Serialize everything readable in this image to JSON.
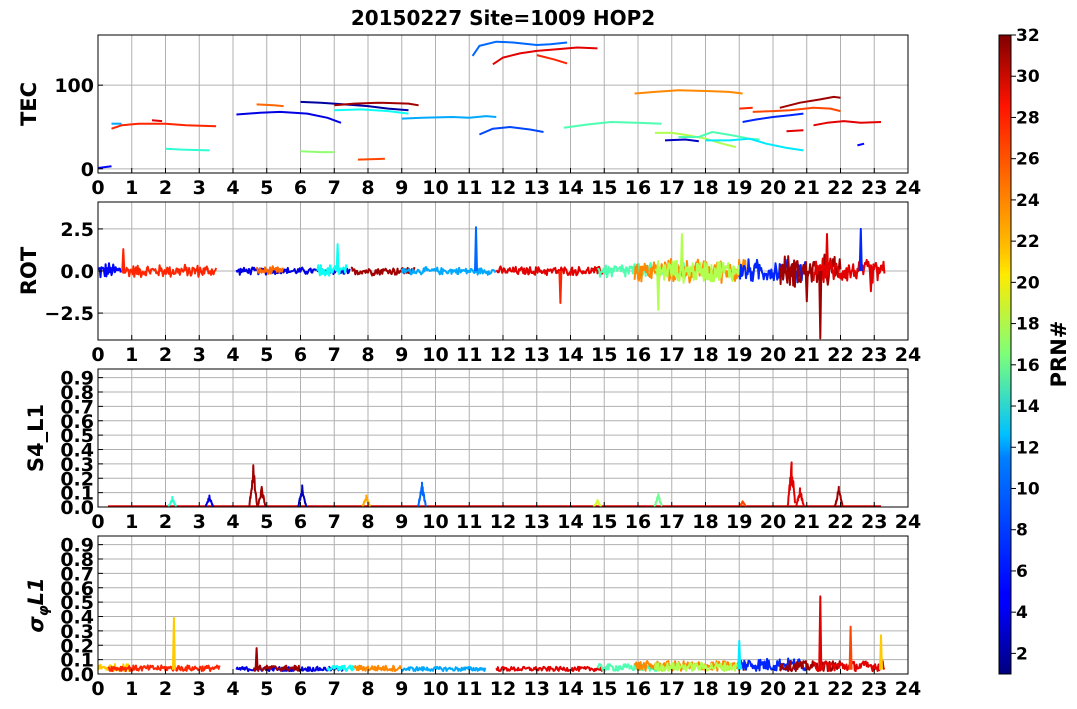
{
  "title": "20150227 Site=1009 HOP2",
  "x_ticks": [
    "0",
    "1",
    "2",
    "3",
    "4",
    "5",
    "6",
    "7",
    "8",
    "9",
    "10",
    "11",
    "12",
    "13",
    "14",
    "15",
    "16",
    "17",
    "18",
    "19",
    "20",
    "21",
    "22",
    "23",
    "24"
  ],
  "colorbar": {
    "label": "PRN#",
    "ticks": [
      "2",
      "4",
      "6",
      "8",
      "10",
      "12",
      "14",
      "16",
      "18",
      "20",
      "22",
      "24",
      "26",
      "28",
      "30",
      "32"
    ],
    "range": [
      1,
      32
    ],
    "colormap": "jet"
  },
  "chart_data": [
    {
      "type": "line",
      "ylabel": "TEC",
      "xlim": [
        0,
        24
      ],
      "ylim": [
        -5,
        160
      ],
      "yticks": [
        "0",
        "100"
      ],
      "ytick_values": [
        0,
        100
      ],
      "grid": true,
      "series": [
        {
          "prn": 5,
          "points": [
            [
              0.0,
              1
            ],
            [
              0.4,
              3
            ]
          ]
        },
        {
          "prn": 10,
          "points": [
            [
              0.4,
              54
            ],
            [
              0.7,
              54
            ]
          ]
        },
        {
          "prn": 27,
          "points": [
            [
              0.4,
              48
            ],
            [
              0.7,
              52
            ],
            [
              1.2,
              54
            ],
            [
              2.0,
              54
            ],
            [
              2.6,
              52
            ],
            [
              3.5,
              51
            ]
          ]
        },
        {
          "prn": 29,
          "points": [
            [
              1.6,
              58
            ],
            [
              1.9,
              57
            ]
          ]
        },
        {
          "prn": 14,
          "points": [
            [
              2.0,
              24
            ],
            [
              2.5,
              23
            ],
            [
              3.3,
              22
            ]
          ]
        },
        {
          "prn": 4,
          "points": [
            [
              4.1,
              65
            ],
            [
              4.8,
              67
            ],
            [
              5.4,
              68
            ],
            [
              6.2,
              66
            ],
            [
              6.8,
              61
            ],
            [
              7.2,
              55
            ]
          ]
        },
        {
          "prn": 25,
          "points": [
            [
              4.7,
              77
            ],
            [
              5.2,
              76
            ],
            [
              5.5,
              75
            ]
          ]
        },
        {
          "prn": 17,
          "points": [
            [
              6.0,
              21
            ],
            [
              6.6,
              20
            ],
            [
              7.0,
              20
            ]
          ]
        },
        {
          "prn": 2,
          "points": [
            [
              6.0,
              80
            ],
            [
              6.6,
              79
            ],
            [
              7.3,
              77
            ],
            [
              8.0,
              75
            ],
            [
              8.6,
              72
            ],
            [
              9.2,
              70
            ]
          ]
        },
        {
          "prn": 31,
          "points": [
            [
              7.0,
              76
            ],
            [
              7.6,
              78
            ],
            [
              8.3,
              79
            ],
            [
              9.2,
              78
            ],
            [
              9.5,
              76
            ]
          ]
        },
        {
          "prn": 26,
          "points": [
            [
              7.7,
              11
            ],
            [
              8.5,
              12
            ]
          ]
        },
        {
          "prn": 13,
          "points": [
            [
              7.0,
              70
            ],
            [
              7.8,
              71
            ],
            [
              8.6,
              69
            ],
            [
              9.2,
              66
            ]
          ]
        },
        {
          "prn": 10,
          "points": [
            [
              9.0,
              60
            ],
            [
              9.6,
              61
            ],
            [
              10.5,
              62
            ],
            [
              11.0,
              61
            ],
            [
              11.5,
              63
            ],
            [
              11.8,
              62
            ]
          ]
        },
        {
          "prn": 8,
          "points": [
            [
              11.1,
              135
            ],
            [
              11.3,
              147
            ],
            [
              11.8,
              152
            ],
            [
              12.3,
              151
            ],
            [
              13.0,
              148
            ],
            [
              13.4,
              149
            ],
            [
              13.9,
              151
            ]
          ]
        },
        {
          "prn": 29,
          "points": [
            [
              11.7,
              125
            ],
            [
              12.0,
              133
            ],
            [
              12.5,
              138
            ],
            [
              13.0,
              141
            ],
            [
              13.6,
              143
            ],
            [
              14.2,
              145
            ],
            [
              14.8,
              144
            ]
          ]
        },
        {
          "prn": 7,
          "points": [
            [
              11.3,
              41
            ],
            [
              11.7,
              48
            ],
            [
              12.2,
              50
            ],
            [
              12.8,
              47
            ],
            [
              13.2,
              44
            ]
          ]
        },
        {
          "prn": 27,
          "points": [
            [
              13.0,
              136
            ],
            [
              13.5,
              131
            ],
            [
              13.9,
              126
            ]
          ]
        },
        {
          "prn": 15,
          "points": [
            [
              13.8,
              49
            ],
            [
              14.5,
              53
            ],
            [
              15.2,
              56
            ],
            [
              16.0,
              55
            ],
            [
              16.7,
              54
            ]
          ]
        },
        {
          "prn": 24,
          "points": [
            [
              15.9,
              90
            ],
            [
              16.5,
              92
            ],
            [
              17.2,
              94
            ],
            [
              18.0,
              93
            ],
            [
              18.7,
              92
            ],
            [
              19.1,
              90
            ]
          ]
        },
        {
          "prn": 18,
          "points": [
            [
              16.5,
              43
            ],
            [
              17.0,
              43
            ],
            [
              17.5,
              40
            ],
            [
              18.0,
              36
            ],
            [
              18.5,
              30
            ],
            [
              18.9,
              26
            ]
          ]
        },
        {
          "prn": 3,
          "points": [
            [
              16.8,
              34
            ],
            [
              17.4,
              35
            ],
            [
              17.8,
              33
            ]
          ]
        },
        {
          "prn": 15,
          "points": [
            [
              17.2,
              38
            ],
            [
              17.8,
              38
            ],
            [
              18.2,
              44
            ],
            [
              18.8,
              40
            ],
            [
              19.3,
              36
            ],
            [
              19.6,
              35
            ]
          ]
        },
        {
          "prn": 12,
          "points": [
            [
              18.0,
              34
            ],
            [
              18.7,
              34
            ],
            [
              19.3,
              36
            ],
            [
              19.8,
              30
            ],
            [
              20.4,
              25
            ],
            [
              20.9,
              22
            ]
          ]
        },
        {
          "prn": 27,
          "points": [
            [
              19.0,
              72
            ],
            [
              19.4,
              73
            ]
          ]
        },
        {
          "prn": 6,
          "points": [
            [
              19.1,
              56
            ],
            [
              19.5,
              59
            ],
            [
              20.0,
              62
            ],
            [
              20.5,
              64
            ],
            [
              20.9,
              66
            ]
          ]
        },
        {
          "prn": 26,
          "points": [
            [
              19.4,
              68
            ],
            [
              20.0,
              69
            ],
            [
              20.5,
              70
            ],
            [
              21.2,
              73
            ],
            [
              21.7,
              72
            ],
            [
              22.0,
              69
            ]
          ]
        },
        {
          "prn": 31,
          "points": [
            [
              20.2,
              73
            ],
            [
              20.8,
              79
            ],
            [
              21.4,
              83
            ],
            [
              21.8,
              86
            ],
            [
              22.0,
              85
            ]
          ]
        },
        {
          "prn": 29,
          "points": [
            [
              20.4,
              45
            ],
            [
              20.9,
              46
            ]
          ]
        },
        {
          "prn": 29,
          "points": [
            [
              21.2,
              52
            ],
            [
              21.6,
              55
            ],
            [
              22.1,
              57
            ],
            [
              22.6,
              55
            ],
            [
              23.2,
              56
            ]
          ]
        },
        {
          "prn": 5,
          "points": [
            [
              22.5,
              28
            ],
            [
              22.7,
              30
            ]
          ]
        }
      ]
    },
    {
      "type": "line",
      "ylabel": "ROT",
      "xlim": [
        0,
        24
      ],
      "ylim": [
        -4.1,
        4.1
      ],
      "yticks": [
        "−2.5",
        "0.0",
        "2.5"
      ],
      "ytick_values": [
        -2.5,
        0,
        2.5
      ],
      "grid": true,
      "series": [
        {
          "prn": 5,
          "noisy": [
            0.0,
            0.7,
            0.6
          ]
        },
        {
          "prn": 27,
          "noisy": [
            0.7,
            3.5,
            0.45
          ]
        },
        {
          "prn": 4,
          "noisy": [
            4.1,
            7.5,
            0.25
          ]
        },
        {
          "prn": 25,
          "noisy": [
            4.7,
            5.5,
            0.3
          ]
        },
        {
          "prn": 13,
          "noisy": [
            6.5,
            7.4,
            0.45
          ]
        },
        {
          "prn": 31,
          "noisy": [
            7.5,
            9.4,
            0.3
          ]
        },
        {
          "prn": 10,
          "noisy": [
            9.0,
            11.8,
            0.25
          ]
        },
        {
          "prn": 29,
          "noisy": [
            11.8,
            15.0,
            0.3
          ]
        },
        {
          "prn": 15,
          "noisy": [
            14.8,
            17.5,
            0.55
          ]
        },
        {
          "prn": 24,
          "noisy": [
            15.9,
            19.2,
            0.8
          ]
        },
        {
          "prn": 18,
          "noisy": [
            16.5,
            19.0,
            0.8
          ]
        },
        {
          "prn": 6,
          "noisy": [
            19.0,
            21.0,
            0.8
          ]
        },
        {
          "prn": 31,
          "noisy": [
            20.2,
            22.0,
            1.1
          ]
        },
        {
          "prn": 29,
          "noisy": [
            21.2,
            23.3,
            0.8
          ]
        }
      ],
      "spikes": [
        {
          "prn": 27,
          "x": 0.75,
          "y": 1.3
        },
        {
          "prn": 13,
          "x": 7.1,
          "y": 1.6
        },
        {
          "prn": 8,
          "x": 11.2,
          "y": 2.6
        },
        {
          "prn": 27,
          "x": 13.7,
          "y": -1.9
        },
        {
          "prn": 18,
          "x": 16.6,
          "y": -2.3
        },
        {
          "prn": 18,
          "x": 17.3,
          "y": 2.2
        },
        {
          "prn": 31,
          "x": 21.0,
          "y": -1.8
        },
        {
          "prn": 31,
          "x": 21.4,
          "y": -4.0
        },
        {
          "prn": 29,
          "x": 21.6,
          "y": 2.2
        },
        {
          "prn": 6,
          "x": 22.6,
          "y": 2.5
        },
        {
          "prn": 29,
          "x": 22.9,
          "y": -1.2
        }
      ]
    },
    {
      "type": "line",
      "ylabel": "S4_L1",
      "xlim": [
        0,
        24
      ],
      "ylim": [
        0,
        0.96
      ],
      "yticks": [
        "0.0",
        "0.1",
        "0.2",
        "0.3",
        "0.4",
        "0.5",
        "0.6",
        "0.7",
        "0.8",
        "0.9"
      ],
      "ytick_values": [
        0,
        0.1,
        0.2,
        0.3,
        0.4,
        0.5,
        0.6,
        0.7,
        0.8,
        0.9
      ],
      "grid": true,
      "baseline_prn": 29,
      "peaks": [
        {
          "prn": 14,
          "x": 2.2,
          "y": 0.07
        },
        {
          "prn": 4,
          "x": 3.3,
          "y": 0.08
        },
        {
          "prn": 31,
          "x": 4.6,
          "y": 0.29
        },
        {
          "prn": 31,
          "x": 4.85,
          "y": 0.14
        },
        {
          "prn": 3,
          "x": 6.05,
          "y": 0.15
        },
        {
          "prn": 23,
          "x": 7.95,
          "y": 0.08
        },
        {
          "prn": 8,
          "x": 9.6,
          "y": 0.17
        },
        {
          "prn": 19,
          "x": 14.8,
          "y": 0.05
        },
        {
          "prn": 16,
          "x": 16.6,
          "y": 0.09
        },
        {
          "prn": 26,
          "x": 19.1,
          "y": 0.04
        },
        {
          "prn": 29,
          "x": 20.55,
          "y": 0.31
        },
        {
          "prn": 29,
          "x": 20.8,
          "y": 0.13
        },
        {
          "prn": 31,
          "x": 21.95,
          "y": 0.14
        }
      ]
    },
    {
      "type": "line",
      "ylabel": "σφL1",
      "xlim": [
        0,
        24
      ],
      "ylim": [
        0,
        0.96
      ],
      "yticks": [
        "0.0",
        "0.1",
        "0.2",
        "0.3",
        "0.4",
        "0.5",
        "0.6",
        "0.7",
        "0.8",
        "0.9"
      ],
      "ytick_values": [
        0,
        0.1,
        0.2,
        0.3,
        0.4,
        0.5,
        0.6,
        0.7,
        0.8,
        0.9
      ],
      "grid": true,
      "series": [
        {
          "prn": 22,
          "noisy": [
            0.0,
            1.0,
            0.05
          ]
        },
        {
          "prn": 27,
          "noisy": [
            0.3,
            3.6,
            0.04
          ]
        },
        {
          "prn": 4,
          "noisy": [
            4.1,
            7.3,
            0.03
          ]
        },
        {
          "prn": 13,
          "noisy": [
            6.8,
            7.6,
            0.04
          ]
        },
        {
          "prn": 24,
          "noisy": [
            7.6,
            9.0,
            0.04
          ]
        },
        {
          "prn": 31,
          "noisy": [
            4.6,
            6.0,
            0.04
          ]
        },
        {
          "prn": 10,
          "noisy": [
            9.0,
            11.5,
            0.03
          ]
        },
        {
          "prn": 29,
          "noisy": [
            11.8,
            15.0,
            0.03
          ]
        },
        {
          "prn": 15,
          "noisy": [
            14.8,
            16.6,
            0.05
          ]
        },
        {
          "prn": 24,
          "noisy": [
            15.9,
            19.2,
            0.07
          ]
        },
        {
          "prn": 18,
          "noisy": [
            16.5,
            19.0,
            0.06
          ]
        },
        {
          "prn": 6,
          "noisy": [
            19.0,
            21.0,
            0.09
          ]
        },
        {
          "prn": 31,
          "noisy": [
            20.2,
            22.0,
            0.07
          ]
        },
        {
          "prn": 29,
          "noisy": [
            21.2,
            23.3,
            0.07
          ]
        }
      ],
      "spikes": [
        {
          "prn": 22,
          "x": 2.25,
          "y": 0.39
        },
        {
          "prn": 31,
          "x": 4.7,
          "y": 0.18
        },
        {
          "prn": 12,
          "x": 19.0,
          "y": 0.23
        },
        {
          "prn": 29,
          "x": 21.4,
          "y": 0.54
        },
        {
          "prn": 26,
          "x": 22.3,
          "y": 0.33
        },
        {
          "prn": 22,
          "x": 23.2,
          "y": 0.27
        }
      ]
    }
  ]
}
